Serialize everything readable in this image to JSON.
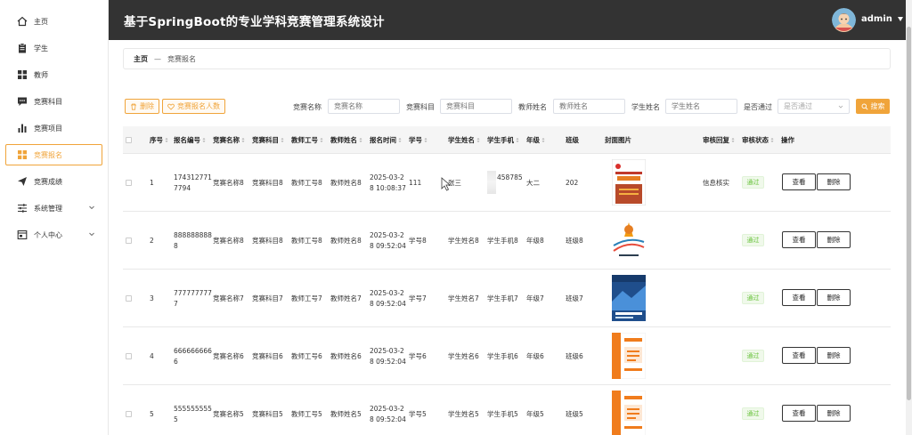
{
  "app": {
    "title": "基于SpringBoot的专业学科竞赛管理系统设计",
    "user": "admin"
  },
  "sidebar": {
    "items": [
      {
        "label": "主页",
        "icon": "home-icon"
      },
      {
        "label": "学生",
        "icon": "clipboard-icon"
      },
      {
        "label": "教师",
        "icon": "grid-icon"
      },
      {
        "label": "竞赛科目",
        "icon": "chat-icon"
      },
      {
        "label": "竞赛项目",
        "icon": "bar-chart-icon"
      },
      {
        "label": "竞赛报名",
        "icon": "grid-icon"
      },
      {
        "label": "竞赛成绩",
        "icon": "send-icon"
      },
      {
        "label": "系统管理",
        "icon": "sliders-icon"
      },
      {
        "label": "个人中心",
        "icon": "window-icon"
      }
    ]
  },
  "breadcrumb": {
    "home": "主页",
    "separator": "—",
    "current": "竞赛报名"
  },
  "toolbar": {
    "delete_label": "删除",
    "stats_label": "竞赛报名人数",
    "search_label": "搜索",
    "filters": [
      {
        "label": "竞赛名称",
        "placeholder": "竞赛名称"
      },
      {
        "label": "竞赛科目",
        "placeholder": "竞赛科目"
      },
      {
        "label": "教师姓名",
        "placeholder": "教师姓名"
      },
      {
        "label": "学生姓名",
        "placeholder": "学生姓名"
      },
      {
        "label": "是否通过",
        "placeholder": "是否通过"
      }
    ]
  },
  "table": {
    "headers": [
      "序号",
      "报名编号",
      "竞赛名称",
      "竞赛科目",
      "教师工号",
      "教师姓名",
      "报名时间",
      "学号",
      "学生姓名",
      "学生手机",
      "年级",
      "班级",
      "封面图片",
      "审核回复",
      "审核状态",
      "操作"
    ],
    "view_label": "查看",
    "delete_label": "删除",
    "rows": [
      {
        "index": "1",
        "code1": "174312771",
        "code2": "7794",
        "comp_name": "竞赛名称8",
        "subject": "竞赛科目8",
        "teacher_no": "教师工号8",
        "teacher_name": "教师姓名8",
        "time1": "2025-03-2",
        "time2": "8 10:08:37",
        "student_no": "111",
        "student_name": "张三",
        "phone": "458785",
        "grade": "大二",
        "class": "202",
        "reply": "信息核实",
        "status": "通过"
      },
      {
        "index": "2",
        "code1": "888888888",
        "code2": "8",
        "comp_name": "竞赛名称8",
        "subject": "竞赛科目8",
        "teacher_no": "教师工号8",
        "teacher_name": "教师姓名8",
        "time1": "2025-03-2",
        "time2": "8 09:52:04",
        "student_no": "学号8",
        "student_name": "学生姓名8",
        "phone": "学生手机8",
        "grade": "年级8",
        "class": "班级8",
        "reply": "",
        "status": "通过"
      },
      {
        "index": "3",
        "code1": "777777777",
        "code2": "7",
        "comp_name": "竞赛名称7",
        "subject": "竞赛科目7",
        "teacher_no": "教师工号7",
        "teacher_name": "教师姓名7",
        "time1": "2025-03-2",
        "time2": "8 09:52:04",
        "student_no": "学号7",
        "student_name": "学生姓名7",
        "phone": "学生手机7",
        "grade": "年级7",
        "class": "班级7",
        "reply": "",
        "status": "通过"
      },
      {
        "index": "4",
        "code1": "666666666",
        "code2": "6",
        "comp_name": "竞赛名称6",
        "subject": "竞赛科目6",
        "teacher_no": "教师工号6",
        "teacher_name": "教师姓名6",
        "time1": "2025-03-2",
        "time2": "8 09:52:04",
        "student_no": "学号6",
        "student_name": "学生姓名6",
        "phone": "学生手机6",
        "grade": "年级6",
        "class": "班级6",
        "reply": "",
        "status": "通过"
      },
      {
        "index": "5",
        "code1": "555555555",
        "code2": "5",
        "comp_name": "竞赛名称5",
        "subject": "竞赛科目5",
        "teacher_no": "教师工号5",
        "teacher_name": "教师姓名5",
        "time1": "2025-03-2",
        "time2": "8 09:52:04",
        "student_no": "学号5",
        "student_name": "学生姓名5",
        "phone": "学生手机5",
        "grade": "年级5",
        "class": "班级5",
        "reply": "",
        "status": "通过"
      }
    ]
  },
  "colors": {
    "accent": "#f0a43a",
    "header_bg": "#333333",
    "success": "#67c23a"
  }
}
